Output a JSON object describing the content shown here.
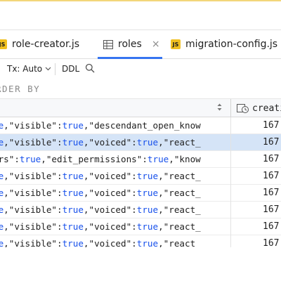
{
  "tabs": [
    {
      "label": "role-creator.js",
      "icon": "js-file-icon",
      "active": false
    },
    {
      "label": "roles",
      "icon": "table-icon",
      "active": true,
      "closable": true
    },
    {
      "label": "migration-config.js",
      "icon": "js-file-icon",
      "active": false
    }
  ],
  "tab_close_glyph": "×",
  "js_badge": "JS",
  "toolbar": {
    "tx_label": "Tx: Auto",
    "ddl_label": "DDL"
  },
  "query": {
    "fragment": "RDER BY"
  },
  "grid": {
    "column2_header": "creati",
    "rows": [
      {
        "segments": [
          [
            "ue",
            "kw"
          ],
          [
            ",\"visible\":",
            ""
          ],
          [
            "true",
            "kw"
          ],
          [
            ",\"descendant_open_know",
            ""
          ]
        ],
        "value": "167",
        "selected": false
      },
      {
        "segments": [
          [
            "ue",
            "kw"
          ],
          [
            ",\"visible\":",
            ""
          ],
          [
            "true",
            "kw"
          ],
          [
            ",\"voiced\":",
            ""
          ],
          [
            "true",
            "kw"
          ],
          [
            ",\"react_",
            ""
          ]
        ],
        "value": "167",
        "selected": true
      },
      {
        "segments": [
          [
            "ers\":",
            ""
          ],
          [
            "true",
            "kw"
          ],
          [
            ",\"edit_permissions\":",
            ""
          ],
          [
            "true",
            "kw"
          ],
          [
            ",\"know",
            ""
          ]
        ],
        "value": "167",
        "selected": false
      },
      {
        "segments": [
          [
            "ue",
            "kw"
          ],
          [
            ",\"visible\":",
            ""
          ],
          [
            "true",
            "kw"
          ],
          [
            ",\"voiced\":",
            ""
          ],
          [
            "true",
            "kw"
          ],
          [
            ",\"react_",
            ""
          ]
        ],
        "value": "167",
        "selected": false
      },
      {
        "segments": [
          [
            "ue",
            "kw"
          ],
          [
            ",\"visible\":",
            ""
          ],
          [
            "true",
            "kw"
          ],
          [
            ",\"voiced\":",
            ""
          ],
          [
            "true",
            "kw"
          ],
          [
            ",\"react_",
            ""
          ]
        ],
        "value": "167",
        "selected": false
      },
      {
        "segments": [
          [
            "ue",
            "kw"
          ],
          [
            ",\"visible\":",
            ""
          ],
          [
            "true",
            "kw"
          ],
          [
            ",\"voiced\":",
            ""
          ],
          [
            "true",
            "kw"
          ],
          [
            ",\"react_",
            ""
          ]
        ],
        "value": "167",
        "selected": false
      },
      {
        "segments": [
          [
            "ue",
            "kw"
          ],
          [
            ",\"visible\":",
            ""
          ],
          [
            "true",
            "kw"
          ],
          [
            ",\"voiced\":",
            ""
          ],
          [
            "true",
            "kw"
          ],
          [
            ",\"react_",
            ""
          ]
        ],
        "value": "167",
        "selected": false
      },
      {
        "segments": [
          [
            "ue",
            "kw"
          ],
          [
            ",\"visible\":",
            ""
          ],
          [
            "true",
            "kw"
          ],
          [
            ",\"voiced\":",
            ""
          ],
          [
            "true",
            "kw"
          ],
          [
            ",\"react_",
            ""
          ]
        ],
        "value": "167",
        "selected": false
      }
    ]
  },
  "colors": {
    "accent": "#3574f0",
    "selection": "#d5e4f7",
    "keyword": "#1750eb"
  }
}
